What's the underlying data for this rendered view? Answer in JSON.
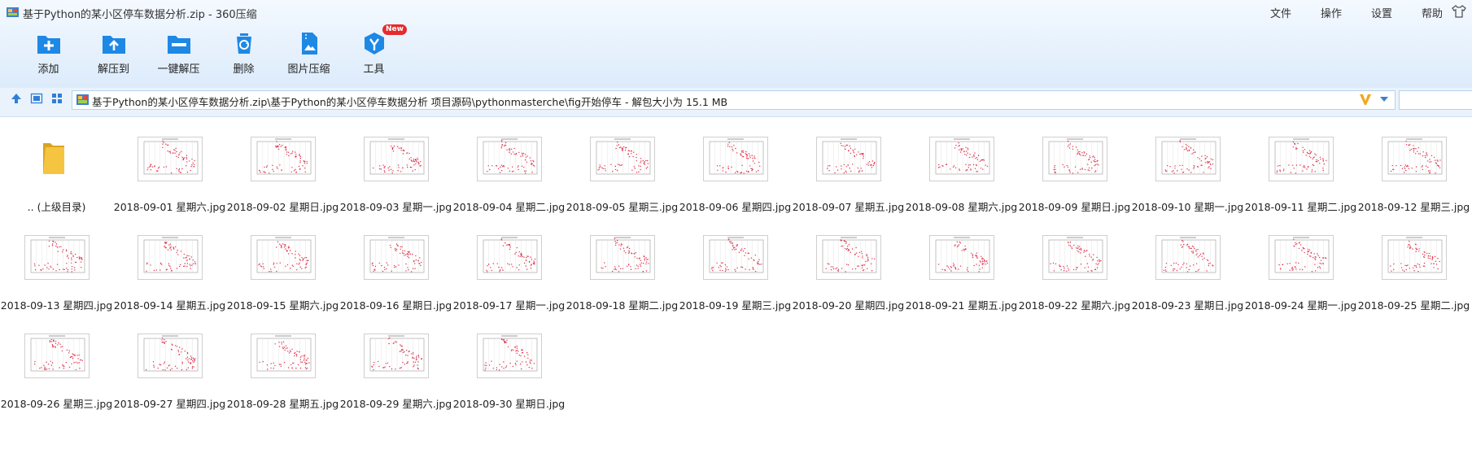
{
  "window": {
    "title": "基于Python的某小区停车数据分析.zip - 360压缩"
  },
  "menu": [
    "文件",
    "操作",
    "设置",
    "帮助"
  ],
  "toolbar": {
    "items": [
      {
        "label": "添加",
        "icon": "add-archive-icon"
      },
      {
        "label": "解压到",
        "icon": "extract-to-icon"
      },
      {
        "label": "一键解压",
        "icon": "one-click-extract-icon"
      },
      {
        "label": "删除",
        "icon": "recycle-bin-icon"
      },
      {
        "label": "图片压缩",
        "icon": "image-compress-icon"
      },
      {
        "label": "工具",
        "icon": "tools-icon",
        "badge": "New"
      }
    ]
  },
  "address": {
    "path": "基于Python的某小区停车数据分析.zip\\基于Python的某小区停车数据分析 项目源码\\pythonmasterche\\fig开始停车 - 解包大小为 15.1 MB",
    "search_value": ""
  },
  "files": {
    "parent": ".. (上级目录)",
    "items": [
      "2018-09-01 星期六.jpg",
      "2018-09-02 星期日.jpg",
      "2018-09-03 星期一.jpg",
      "2018-09-04 星期二.jpg",
      "2018-09-05 星期三.jpg",
      "2018-09-06 星期四.jpg",
      "2018-09-07 星期五.jpg",
      "2018-09-08 星期六.jpg",
      "2018-09-09 星期日.jpg",
      "2018-09-10 星期一.jpg",
      "2018-09-11 星期二.jpg",
      "2018-09-12 星期三.jpg",
      "2018-09-13 星期四.jpg",
      "2018-09-14 星期五.jpg",
      "2018-09-15 星期六.jpg",
      "2018-09-16 星期日.jpg",
      "2018-09-17 星期一.jpg",
      "2018-09-18 星期二.jpg",
      "2018-09-19 星期三.jpg",
      "2018-09-20 星期四.jpg",
      "2018-09-21 星期五.jpg",
      "2018-09-22 星期六.jpg",
      "2018-09-23 星期日.jpg",
      "2018-09-24 星期一.jpg",
      "2018-09-25 星期二.jpg",
      "2018-09-26 星期三.jpg",
      "2018-09-27 星期四.jpg",
      "2018-09-28 星期五.jpg",
      "2018-09-29 星期六.jpg",
      "2018-09-30 星期日.jpg"
    ]
  },
  "colors": {
    "toolbar_icon": "#1e88e5",
    "badge": "#e52b2b",
    "folder": "#f5c542",
    "scatter_point": "#e0304a"
  }
}
